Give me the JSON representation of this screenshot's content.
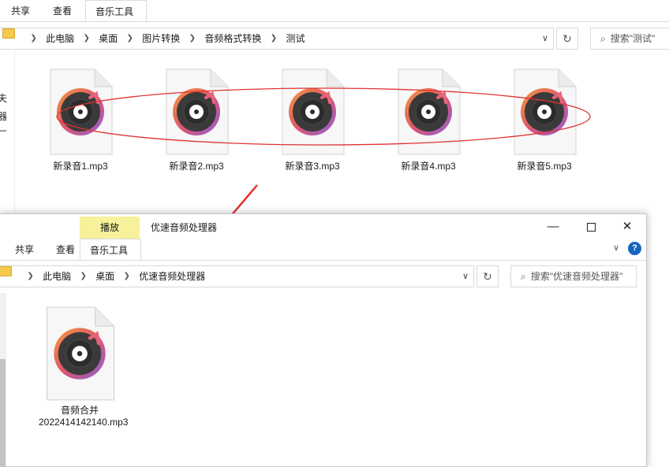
{
  "back": {
    "tabs": [
      "共享",
      "查看",
      "音乐工具"
    ],
    "breadcrumb": [
      "此电脑",
      "桌面",
      "图片转换",
      "音频格式转换",
      "测试"
    ],
    "search_placeholder": "搜索\"测试\"",
    "side_chars": [
      "夫",
      "器",
      "厂"
    ],
    "files": [
      "新录音1.mp3",
      "新录音2.mp3",
      "新录音3.mp3",
      "新录音4.mp3",
      "新录音5.mp3"
    ]
  },
  "front": {
    "context_tab": "播放",
    "title": "优速音频处理器",
    "tabs": [
      "共享",
      "查看",
      "音乐工具"
    ],
    "breadcrumb": [
      "此电脑",
      "桌面",
      "优速音频处理器"
    ],
    "search_placeholder": "搜索\"优速音频处理器\"",
    "file_name_line1": "音频合并",
    "file_name_line2": "2022414142140.mp3",
    "help_glyph": "?"
  },
  "colors": {
    "context_tab_bg": "#f6f19a",
    "annotation_red": "#e03131",
    "help_blue": "#1565c0",
    "folder_yellow": "#f4c94e"
  }
}
